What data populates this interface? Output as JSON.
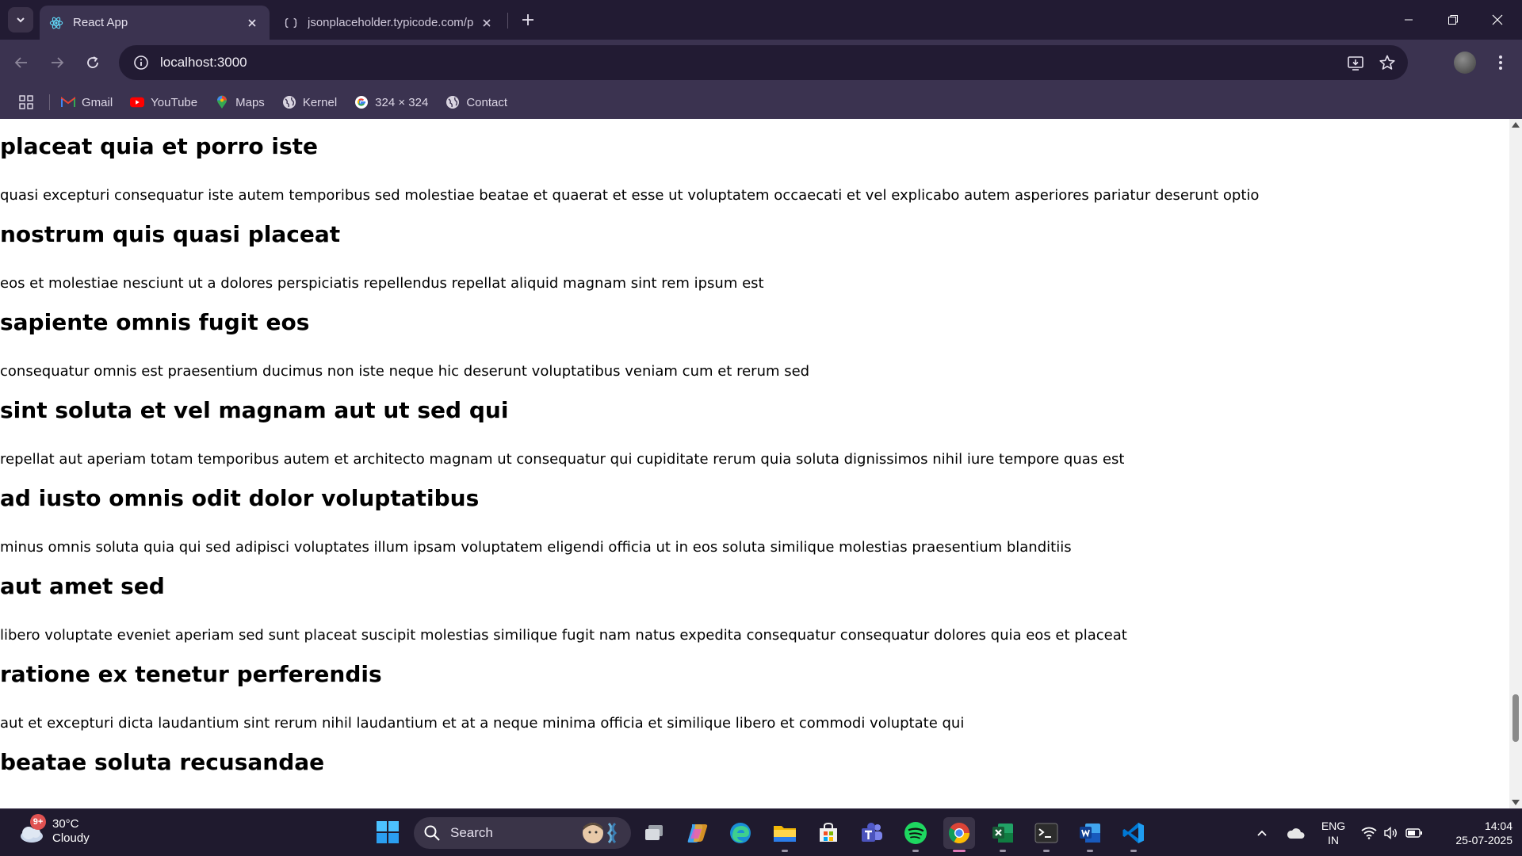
{
  "browser": {
    "tabs": [
      {
        "title": "React App",
        "active": true,
        "favicon": "react-icon"
      },
      {
        "title": "jsonplaceholder.typicode.com/p",
        "active": false,
        "favicon": "jsonplaceholder-icon"
      }
    ],
    "address": "localhost:3000",
    "bookmarks": [
      {
        "label": "Gmail",
        "icon": "gmail-icon"
      },
      {
        "label": "YouTube",
        "icon": "youtube-icon"
      },
      {
        "label": "Maps",
        "icon": "maps-icon"
      },
      {
        "label": "Kernel",
        "icon": "globe-icon"
      },
      {
        "label": "324 × 324",
        "icon": "google-icon"
      },
      {
        "label": "Contact",
        "icon": "globe-icon"
      }
    ]
  },
  "posts": [
    {
      "title": "placeat quia et porro iste",
      "body": "quasi excepturi consequatur iste autem temporibus sed molestiae beatae et quaerat et esse ut voluptatem occaecati et vel explicabo autem asperiores pariatur deserunt optio"
    },
    {
      "title": "nostrum quis quasi placeat",
      "body": "eos et molestiae nesciunt ut a dolores perspiciatis repellendus repellat aliquid magnam sint rem ipsum est"
    },
    {
      "title": "sapiente omnis fugit eos",
      "body": "consequatur omnis est praesentium ducimus non iste neque hic deserunt voluptatibus veniam cum et rerum sed"
    },
    {
      "title": "sint soluta et vel magnam aut ut sed qui",
      "body": "repellat aut aperiam totam temporibus autem et architecto magnam ut consequatur qui cupiditate rerum quia soluta dignissimos nihil iure tempore quas est"
    },
    {
      "title": "ad iusto omnis odit dolor voluptatibus",
      "body": "minus omnis soluta quia qui sed adipisci voluptates illum ipsam voluptatem eligendi officia ut in eos soluta similique molestias praesentium blanditiis"
    },
    {
      "title": "aut amet sed",
      "body": "libero voluptate eveniet aperiam sed sunt placeat suscipit molestias similique fugit nam natus expedita consequatur consequatur dolores quia eos et placeat"
    },
    {
      "title": "ratione ex tenetur perferendis",
      "body": "aut et excepturi dicta laudantium sint rerum nihil laudantium et at a neque minima officia et similique libero et commodi voluptate qui"
    },
    {
      "title": "beatae soluta recusandae",
      "body": ""
    }
  ],
  "taskbar": {
    "weather": {
      "temp": "30°C",
      "condition": "Cloudy",
      "badge": "9+"
    },
    "search_label": "Search",
    "apps": [
      "task-view-icon",
      "copilot-icon",
      "edge-icon",
      "file-explorer-icon",
      "microsoft-store-icon",
      "teams-icon",
      "spotify-icon",
      "chrome-icon",
      "excel-icon",
      "terminal-icon",
      "word-icon",
      "vscode-icon"
    ],
    "language": {
      "line1": "ENG",
      "line2": "IN"
    },
    "time": "14:04",
    "date": "25-07-2025"
  }
}
